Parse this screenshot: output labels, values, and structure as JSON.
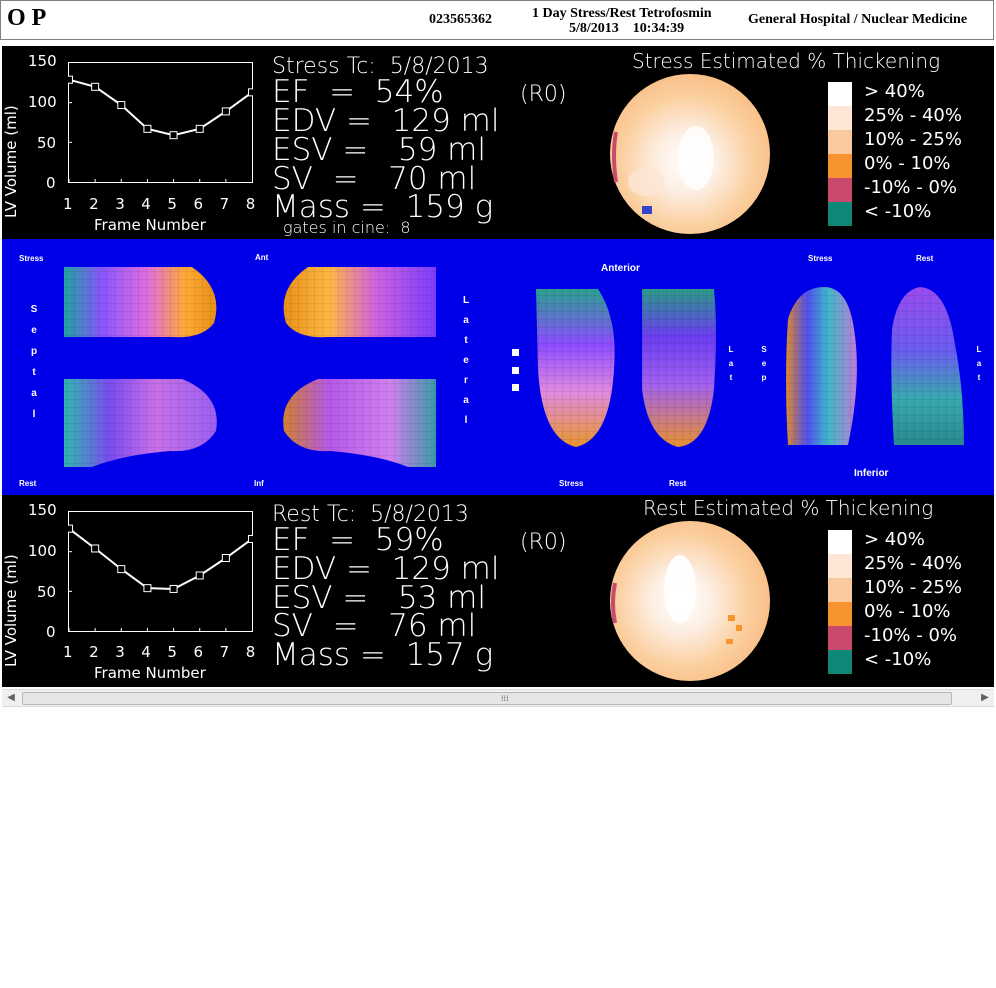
{
  "header": {
    "patient": "O P",
    "accession": "023565362",
    "study": "1 Day Stress/Rest Tetrofosmin",
    "date": "5/8/2013",
    "time": "10:34:39",
    "institution": "General Hospital / Nuclear Medicine"
  },
  "stress": {
    "title": "Stress Tc:  5/8/2013",
    "ef": "EF  =  54%",
    "ef_suffix": "(R0)",
    "edv": "EDV =  129 ml",
    "esv": "ESV =   59 ml",
    "sv": "SV  =   70 ml",
    "mass": "Mass =  159 g",
    "gates": "gates in cine:  8",
    "thickening_title": "Stress Estimated % Thickening"
  },
  "rest": {
    "title": "Rest Tc:  5/8/2013",
    "ef": "EF  =  59%",
    "ef_suffix": "(R0)",
    "edv": "EDV =  129 ml",
    "esv": "ESV =   53 ml",
    "sv": "SV  =   76 ml",
    "mass": "Mass =  157 g",
    "thickening_title": "Rest Estimated % Thickening"
  },
  "plot": {
    "ylabel": "LV Volume (ml)",
    "xlabel": "Frame Number",
    "yticks": [
      "150",
      "100",
      "50",
      "0"
    ],
    "xticks": [
      "1",
      "2",
      "3",
      "4",
      "5",
      "6",
      "7",
      "8"
    ]
  },
  "legend": {
    "items": [
      {
        "label": "> 40%",
        "color": "#ffffff"
      },
      {
        "label": "25% - 40%",
        "color": "#fde6d6"
      },
      {
        "label": "10% - 25%",
        "color": "#fbc9a0"
      },
      {
        "label": "0% - 10%",
        "color": "#f7942f"
      },
      {
        "label": "-10% - 0%",
        "color": "#c94a6c"
      },
      {
        "label": "< -10%",
        "color": "#0f8878"
      }
    ]
  },
  "surface": {
    "stress": "Stress",
    "rest": "Rest",
    "ant": "Ant",
    "inf": "Inf",
    "septal": [
      "S",
      "e",
      "p",
      "t",
      "a",
      "l"
    ],
    "lateral": [
      "L",
      "a",
      "t",
      "e",
      "r",
      "a",
      "l"
    ],
    "anterior": "Anterior",
    "inferior": "Inferior",
    "lat": [
      "L",
      "a",
      "t"
    ],
    "sep": [
      "S",
      "e",
      "p"
    ]
  },
  "chart_data": [
    {
      "type": "line",
      "title": "Stress",
      "xlabel": "Frame Number",
      "ylabel": "LV Volume (ml)",
      "x": [
        1,
        2,
        3,
        4,
        5,
        6,
        7,
        8
      ],
      "series": [
        {
          "values": [
            129,
            120,
            97,
            67,
            59,
            67,
            89,
            113
          ]
        }
      ],
      "xlim": [
        1,
        8
      ],
      "ylim": [
        0,
        150
      ]
    },
    {
      "type": "line",
      "title": "Rest",
      "xlabel": "Frame Number",
      "ylabel": "LV Volume (ml)",
      "x": [
        1,
        2,
        3,
        4,
        5,
        6,
        7,
        8
      ],
      "series": [
        {
          "values": [
            129,
            104,
            78,
            54,
            53,
            70,
            92,
            116
          ]
        }
      ],
      "xlim": [
        1,
        8
      ],
      "ylim": [
        0,
        150
      ]
    }
  ]
}
